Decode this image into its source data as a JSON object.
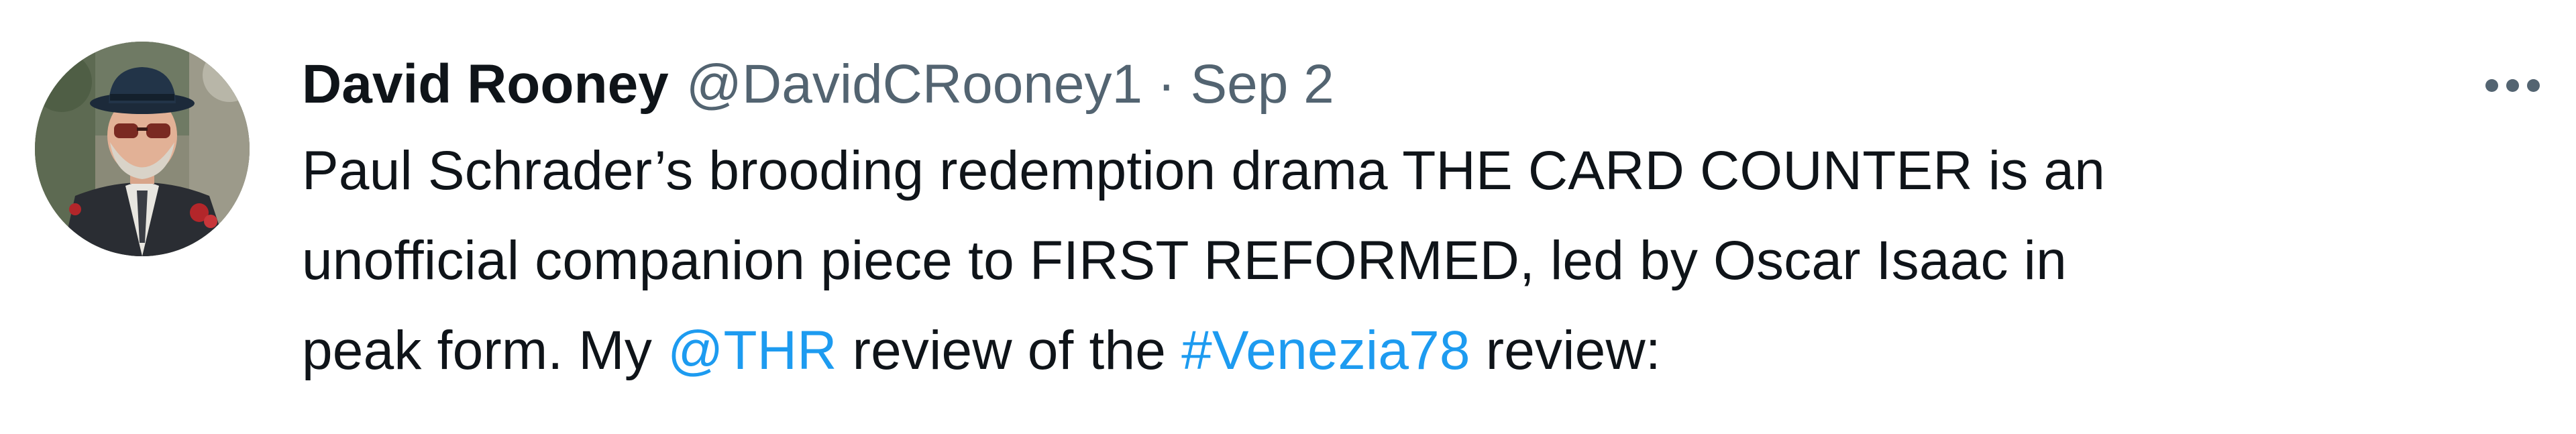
{
  "tweet": {
    "author": {
      "display_name": "David Rooney",
      "handle": "@DavidCRooney1",
      "avatar_icon": "user-avatar-photo"
    },
    "separator": "·",
    "date": "Sep 2",
    "text": {
      "line1": "Paul Schrader’s brooding redemption drama THE CARD COUNTER is an",
      "line2": "unofficial companion piece to FIRST REFORMED, led by Oscar Isaac in",
      "line3_prefix": "peak form. My ",
      "mention": "@THR",
      "line3_middle": " review of the ",
      "hashtag": "#Venezia78",
      "line3_suffix": " review:"
    },
    "more_icon": "more-horizontal-icon"
  },
  "colors": {
    "text_primary": "#0f1419",
    "text_secondary": "#536471",
    "link": "#1d9bf0",
    "background": "#ffffff"
  }
}
